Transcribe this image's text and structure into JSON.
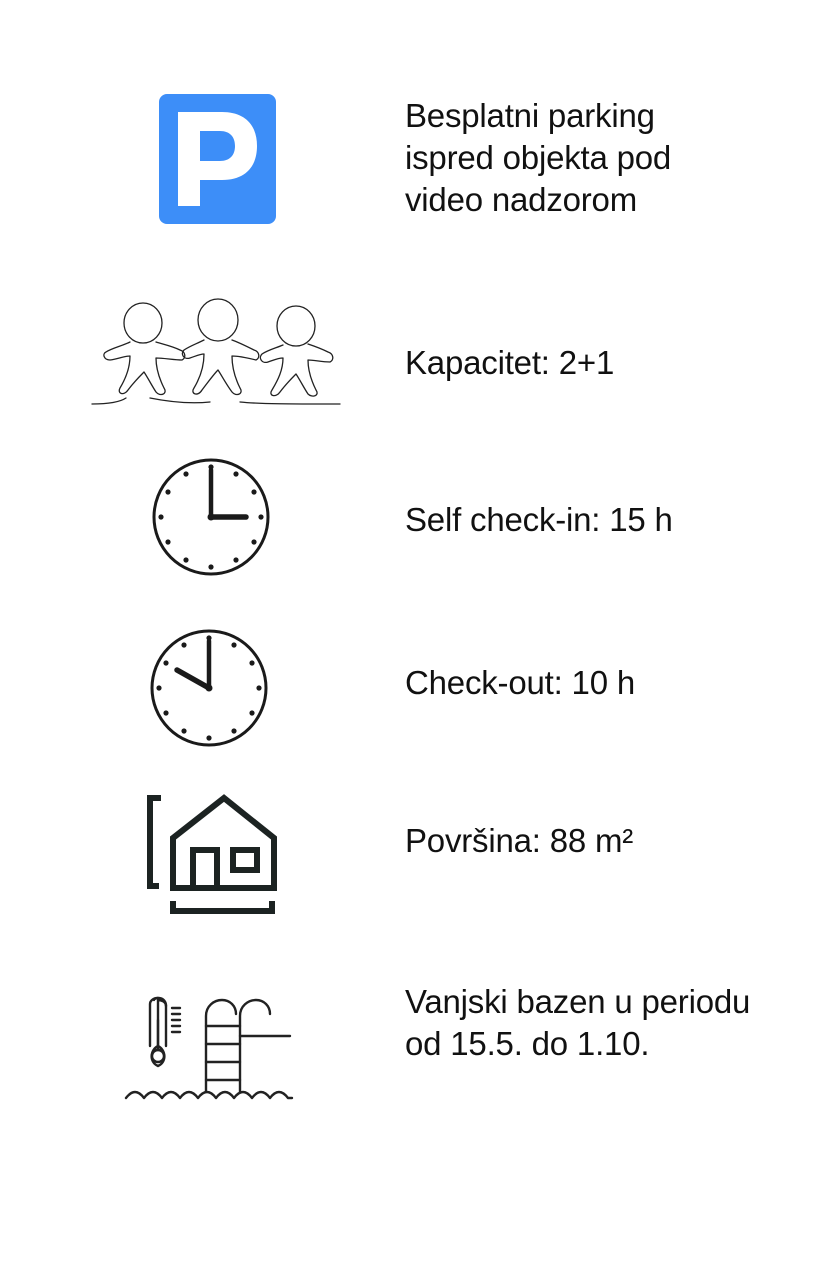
{
  "items": [
    {
      "icon": "parking-icon",
      "lines": [
        "Besplatni parking",
        "ispred objekta pod",
        "video nadzorom"
      ]
    },
    {
      "icon": "people-icon",
      "lines": [
        "Kapacitet: 2+1"
      ]
    },
    {
      "icon": "clock-icon",
      "lines": [
        "Self check-in: 15 h"
      ]
    },
    {
      "icon": "clock-icon",
      "lines": [
        "Check-out: 10 h"
      ]
    },
    {
      "icon": "house-area-icon",
      "lines": [
        "Površina: 88 m²"
      ]
    },
    {
      "icon": "pool-icon",
      "lines": [
        "Vanjski bazen u periodu",
        "od 15.5. do 1.10."
      ]
    }
  ],
  "colors": {
    "parking_blue": "#3d8ef8",
    "text": "#111111",
    "icon_dark": "#1a1a1a"
  }
}
